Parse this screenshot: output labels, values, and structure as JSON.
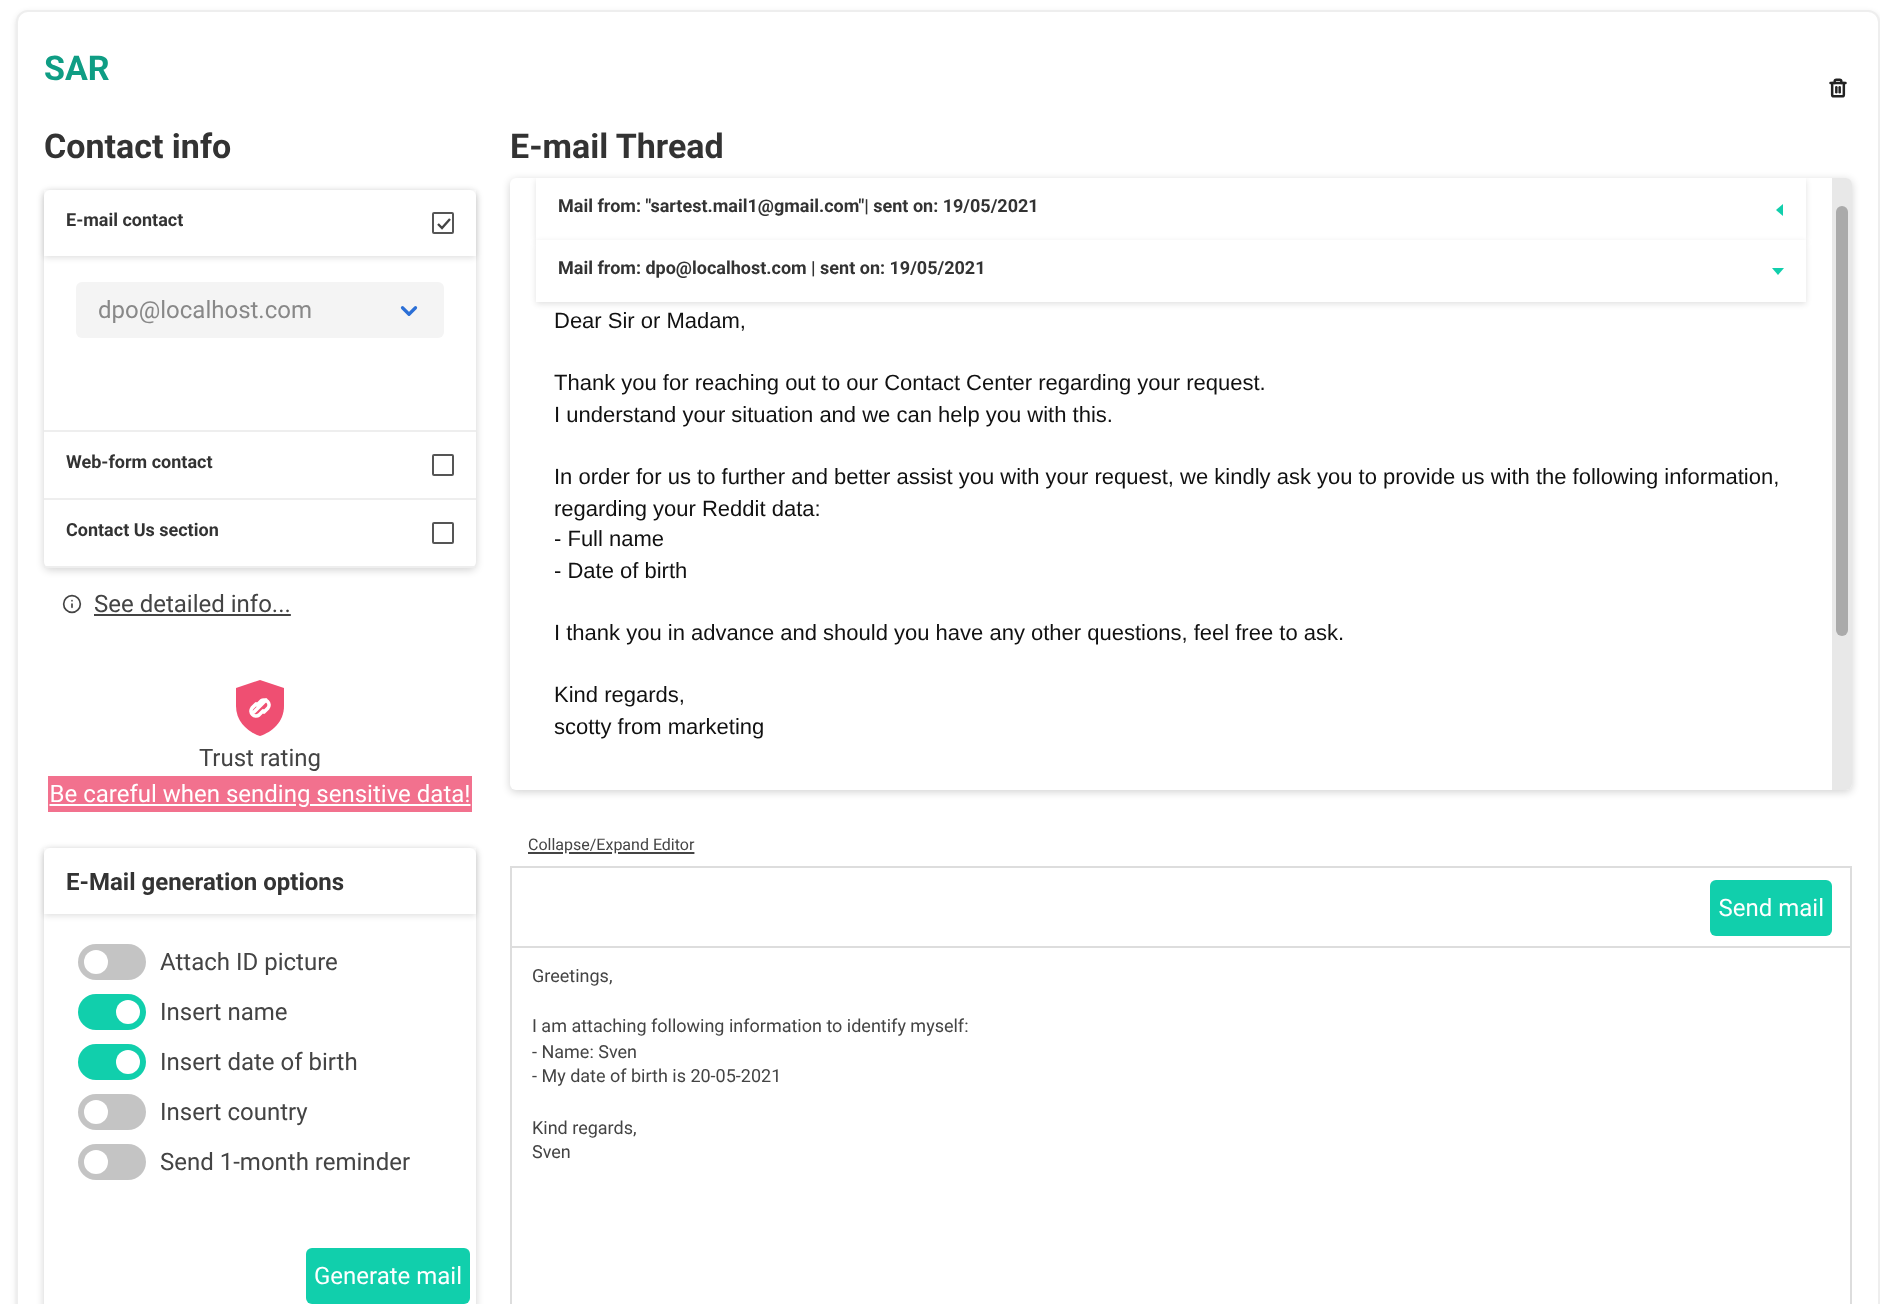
{
  "app_title": "SAR",
  "contact": {
    "heading": "Contact info",
    "methods": [
      {
        "label": "E-mail contact",
        "checked": true,
        "expanded": true,
        "select_value": "dpo@localhost.com"
      },
      {
        "label": "Web-form contact",
        "checked": false,
        "expanded": false
      },
      {
        "label": "Contact Us section",
        "checked": false,
        "expanded": false
      }
    ],
    "details_link": "See detailed info..."
  },
  "trust": {
    "label": "Trust rating",
    "warning": "Be careful when sending sensitive data!"
  },
  "options": {
    "title": "E-Mail generation options",
    "toggles": [
      {
        "label": "Attach ID picture",
        "on": false
      },
      {
        "label": "Insert name",
        "on": true
      },
      {
        "label": "Insert date of birth",
        "on": true
      },
      {
        "label": "Insert country",
        "on": false
      },
      {
        "label": "Send 1-month reminder",
        "on": false
      }
    ],
    "button": "Generate mail"
  },
  "thread": {
    "heading": "E-mail Thread",
    "mails": [
      {
        "header": "Mail from: \"sartest.mail1@gmail.com\"| sent on: 19/05/2021",
        "expanded": false
      },
      {
        "header": "Mail from: dpo@localhost.com | sent on: 19/05/2021",
        "expanded": true,
        "paragraphs": [
          [
            "Dear Sir or Madam,"
          ],
          [
            "Thank you for reaching out to our Contact Center regarding your request.",
            "I understand your situation and we can help you with this."
          ],
          [
            "In order for us to further and better assist you with your request, we kindly ask you to provide us with the following information, regarding your Reddit data:",
            "- Full name",
            "- Date of birth"
          ],
          [
            "I thank you in advance and should you have any other questions, feel free to ask."
          ],
          [
            "Kind regards,",
            "scotty from marketing"
          ]
        ]
      }
    ]
  },
  "editor": {
    "toggle_link": "Collapse/Expand Editor",
    "send_button": "Send mail",
    "paragraphs": [
      [
        "Greetings,"
      ],
      [
        "I am attaching following information to identify myself:",
        "- Name: Sven",
        "- My date of birth is 20-05-2021"
      ],
      [
        "Kind regards,",
        "Sven"
      ]
    ]
  }
}
